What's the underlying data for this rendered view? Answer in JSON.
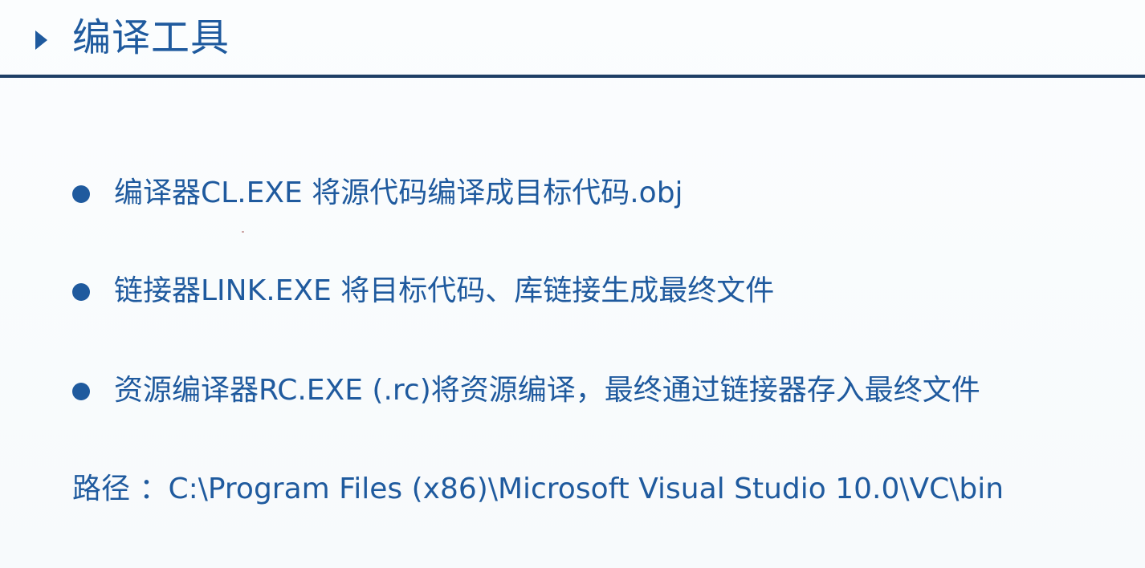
{
  "slide": {
    "title": "编译工具",
    "bullets": [
      {
        "text": "编译器CL.EXE   将源代码编译成目标代码.obj"
      },
      {
        "text": "链接器LINK.EXE   将目标代码、库链接生成最终文件"
      },
      {
        "text": "资源编译器RC.EXE   (.rc)将资源编译，最终通过链接器存入最终文件"
      }
    ],
    "path_line": "路径 ：C:\\Program Files (x86)\\Microsoft Visual Studio 10.0\\VC\\bin"
  },
  "colors": {
    "text": "#1f5a9e",
    "rule": "#1f3f66",
    "background": "#fafcfd"
  }
}
